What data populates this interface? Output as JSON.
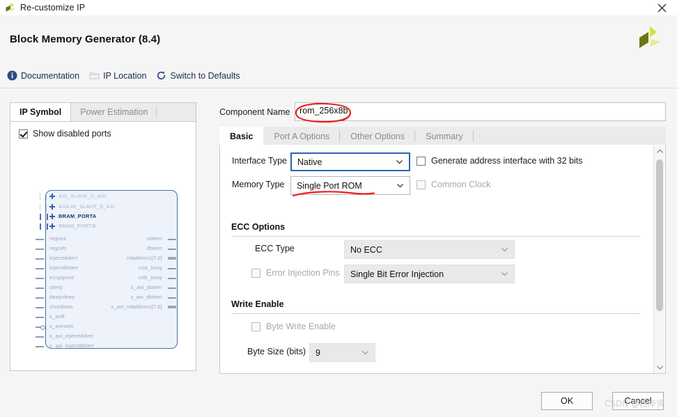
{
  "window": {
    "title": "Re-customize IP",
    "icon": "xilinx-logo-icon",
    "close_icon": "close-icon"
  },
  "header": {
    "title": "Block Memory Generator (8.4)",
    "logo": "xilinx-logo-icon",
    "toolbar": [
      {
        "label": "Documentation",
        "icon": "info-icon",
        "enabled": true
      },
      {
        "label": "IP Location",
        "icon": "folder-icon",
        "enabled": false
      },
      {
        "label": "Switch to Defaults",
        "icon": "refresh-icon",
        "enabled": true
      }
    ]
  },
  "left_panel": {
    "tabs": [
      {
        "label": "IP Symbol",
        "active": true
      },
      {
        "label": "Power Estimation",
        "active": false
      }
    ],
    "show_disabled_ports": {
      "label": "Show disabled ports",
      "checked": true
    },
    "symbol": {
      "interfaces": [
        {
          "name": "AXI_SLAVE_S_AXI",
          "enabled": false,
          "bus": "dotted"
        },
        {
          "name": "AXILite_SLAVE_S_AXI",
          "enabled": false,
          "bus": "dotted"
        },
        {
          "name": "BRAM_PORTA",
          "enabled": true,
          "bus": "solid"
        },
        {
          "name": "BRAM_PORTB",
          "enabled": false,
          "bus": "solid"
        }
      ],
      "left_ports": [
        {
          "name": "regcea",
          "type": "single"
        },
        {
          "name": "regceb",
          "type": "single"
        },
        {
          "name": "injectsbiterr",
          "type": "single"
        },
        {
          "name": "injectdbiterr",
          "type": "single"
        },
        {
          "name": "eccpipece",
          "type": "single"
        },
        {
          "name": "sleep",
          "type": "single"
        },
        {
          "name": "deepsleep",
          "type": "single"
        },
        {
          "name": "shutdown",
          "type": "single"
        },
        {
          "name": "s_aclk",
          "type": "single"
        },
        {
          "name": "s_aresetn",
          "type": "inverted"
        },
        {
          "name": "s_axi_injectsbiterr",
          "type": "single"
        },
        {
          "name": "s_axi_injectdbiterr",
          "type": "single"
        }
      ],
      "right_ports": [
        {
          "name": "sbiterr",
          "type": "single"
        },
        {
          "name": "dbiterr",
          "type": "single"
        },
        {
          "name": "rdaddrecc[7:0]",
          "type": "bus"
        },
        {
          "name": "rsta_busy",
          "type": "single"
        },
        {
          "name": "rstb_busy",
          "type": "single"
        },
        {
          "name": "s_axi_sbiterr",
          "type": "single"
        },
        {
          "name": "s_axi_dbiterr",
          "type": "single"
        },
        {
          "name": "s_axi_rdaddrecc[7:0]",
          "type": "bus"
        }
      ]
    }
  },
  "main": {
    "component_name": {
      "label": "Component Name",
      "value": "rom_256x8b",
      "annotated": true
    },
    "tabs": [
      {
        "label": "Basic",
        "active": true
      },
      {
        "label": "Port A Options",
        "active": false
      },
      {
        "label": "Other Options",
        "active": false
      },
      {
        "label": "Summary",
        "active": false
      }
    ],
    "basic": {
      "interface_type": {
        "label": "Interface Type",
        "value": "Native",
        "focused": true,
        "enabled": true
      },
      "memory_type": {
        "label": "Memory Type",
        "value": "Single Port ROM",
        "focused": false,
        "enabled": true,
        "annotated": true
      },
      "generate_address_interface": {
        "label": "Generate address interface with 32 bits",
        "checked": false,
        "enabled": true
      },
      "common_clock": {
        "label": "Common Clock",
        "checked": false,
        "enabled": false
      },
      "ecc_options": {
        "title": "ECC Options",
        "ecc_type": {
          "label": "ECC Type",
          "value": "No ECC",
          "enabled": false
        },
        "error_injection_pins": {
          "label": "Error Injection Pins",
          "checked": false,
          "enabled": false,
          "value": "Single Bit Error Injection"
        }
      },
      "write_enable": {
        "title": "Write Enable",
        "byte_write_enable": {
          "label": "Byte Write Enable",
          "checked": false,
          "enabled": false
        },
        "byte_size": {
          "label": "Byte Size (bits)",
          "value": "9",
          "enabled": false
        }
      }
    },
    "scrollbar": {
      "up_icon": "chevron-up-icon",
      "down_icon": "chevron-down-icon"
    }
  },
  "footer": {
    "ok_label": "OK",
    "cancel_label": "Cancel",
    "watermark": "CSDN @西岸贤"
  },
  "colors": {
    "accent_blue": "#2a63b5",
    "annotation_red": "#ee1c1c",
    "xilinx_green": "#c9d62c",
    "xilinx_olive": "#6f7512",
    "link_navy": "#1b2a52",
    "symbol_border": "#4a6fa5"
  }
}
